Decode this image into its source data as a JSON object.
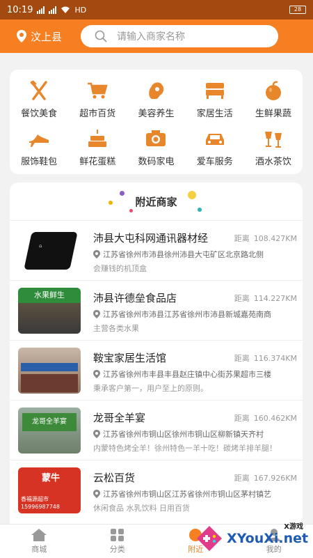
{
  "status_bar": {
    "time": "10:19",
    "network": "HD",
    "battery": "28"
  },
  "header": {
    "location": "汶上县",
    "search_placeholder": "请输入商家名称"
  },
  "categories": [
    {
      "label": "餐饮美食",
      "icon": "fork-knife-icon"
    },
    {
      "label": "超市百货",
      "icon": "shopping-cart-icon"
    },
    {
      "label": "美容养生",
      "icon": "beauty-icon"
    },
    {
      "label": "家居生活",
      "icon": "bed-icon"
    },
    {
      "label": "生鲜果蔬",
      "icon": "apple-icon"
    },
    {
      "label": "服饰鞋包",
      "icon": "high-heel-icon"
    },
    {
      "label": "鲜花蛋糕",
      "icon": "cake-icon"
    },
    {
      "label": "数码家电",
      "icon": "camera-icon"
    },
    {
      "label": "爱车服务",
      "icon": "car-icon"
    },
    {
      "label": "酒水茶饮",
      "icon": "cheers-icon"
    }
  ],
  "nearby": {
    "title": "附近商家",
    "distance_label": "距离",
    "items": [
      {
        "name": "沛县大屯科网通讯器材经",
        "distance": "108.427KM",
        "address": "江苏省徐州市沛县徐州沛县大屯矿区北京路北侧",
        "desc": "会赚钱的机顶盒"
      },
      {
        "name": "沛县许德垒食品店",
        "distance": "114.227KM",
        "address": "江苏省徐州市沛县江苏省徐州市沛县新城嘉苑南商",
        "desc": "主营各类水果"
      },
      {
        "name": "鞍宝家居生活馆",
        "distance": "116.374KM",
        "address": "江苏省徐州市丰县丰县赵庄镇中心街苏果超市三楼",
        "desc": "秉承客户第一，用户至上的原则。"
      },
      {
        "name": "龙哥全羊宴",
        "distance": "160.462KM",
        "address": "江苏省徐州市铜山区徐州市铜山区柳新镇天齐村",
        "desc": "内蒙特色烤全羊！徐州特色一羊十吃！碳烤羊排羊腿！"
      },
      {
        "name": "云松百货",
        "distance": "167.926KM",
        "address": "江苏省徐州市铜山区江苏省徐州市铜山区茅村镇艺",
        "desc": "休闲食品 水乳饮料 日用百货"
      }
    ],
    "thumb_texts": [
      "水果鲜生",
      "龙哥全羊宴",
      "蒙牛",
      "香福源超市",
      "15996987748"
    ]
  },
  "tabs": [
    {
      "label": "商城",
      "icon": "home-icon"
    },
    {
      "label": "分类",
      "icon": "grid-icon"
    },
    {
      "label": "附近",
      "icon": "nearby-icon"
    },
    {
      "label": "我的",
      "icon": "user-icon"
    }
  ],
  "watermark": {
    "text": "XYouXi.net",
    "small": "X游戏"
  },
  "colors": {
    "accent": "#f67f22",
    "status_bar": "#a34a10",
    "icon": "#e8862c"
  }
}
